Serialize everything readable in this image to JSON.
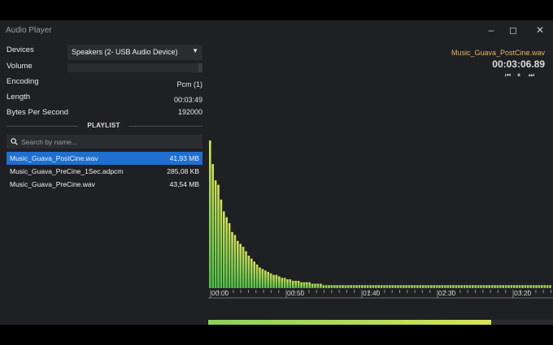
{
  "window": {
    "title": "Audio Player"
  },
  "controls": {
    "devices_label": "Devices",
    "device_value": "Speakers (2- USB Audio Device)",
    "volume_label": "Volume",
    "volume_level": 1.0,
    "encoding_label": "Encoding",
    "encoding_value": "Pcm (1)",
    "length_label": "Length",
    "length_value": "00:03:49",
    "bps_label": "Bytes Per Second",
    "bps_value": "192000"
  },
  "playlist": {
    "title": "PLAYLIST",
    "search_placeholder": "Search by name...",
    "items": [
      {
        "name": "Music_Guava_PostCine.wav",
        "size": "41,93 MB",
        "selected": true
      },
      {
        "name": "Music_Guava_PreCine_1Sec.adpcm",
        "size": "285,08 KB",
        "selected": false
      },
      {
        "name": "Music_Guava_PreCine.wav",
        "size": "43,54 MB",
        "selected": false
      }
    ]
  },
  "now_playing": {
    "file": "Music_Guava_PostCine.wav",
    "time": "00:03:06.89",
    "progress": 0.82
  },
  "spectrum": {
    "timeline_labels": [
      "00:00",
      "00:50",
      "01:40",
      "02:30",
      "03:20"
    ],
    "levels": [
      1.0,
      0.84,
      0.73,
      0.7,
      0.6,
      0.52,
      0.48,
      0.44,
      0.38,
      0.36,
      0.32,
      0.3,
      0.28,
      0.25,
      0.22,
      0.2,
      0.18,
      0.16,
      0.14,
      0.13,
      0.12,
      0.11,
      0.1,
      0.09,
      0.09,
      0.08,
      0.07,
      0.07,
      0.06,
      0.06,
      0.05,
      0.05,
      0.05,
      0.04,
      0.04,
      0.04,
      0.04,
      0.03,
      0.03,
      0.03,
      0.03,
      0.02,
      0.02,
      0.02,
      0.02,
      0.02,
      0.02,
      0.02,
      0.02,
      0.02,
      0.02,
      0.02,
      0.02,
      0.02,
      0.02,
      0.02,
      0.02,
      0.02,
      0.02,
      0.02,
      0.02,
      0.02,
      0.02,
      0.02,
      0.02,
      0.02,
      0.02,
      0.02,
      0.02,
      0.02,
      0.02,
      0.02,
      0.02,
      0.02,
      0.02,
      0.02,
      0.02,
      0.02,
      0.02,
      0.02,
      0.02,
      0.02,
      0.02,
      0.02,
      0.02,
      0.02,
      0.02,
      0.02,
      0.02,
      0.02,
      0.02,
      0.02,
      0.02,
      0.02,
      0.02,
      0.02,
      0.02,
      0.02,
      0.02,
      0.02,
      0.02,
      0.02,
      0.02,
      0.02,
      0.02,
      0.02,
      0.02,
      0.02,
      0.02,
      0.02,
      0.02,
      0.02,
      0.02,
      0.02,
      0.02,
      0.02,
      0.02,
      0.02,
      0.02,
      0.02,
      0.02,
      0.02,
      0.02,
      0.02,
      0.02,
      0.02,
      0.02,
      0.02,
      0.02,
      0.02
    ],
    "colors": {
      "low": "#4fc247",
      "high": "#d4e35a"
    }
  }
}
